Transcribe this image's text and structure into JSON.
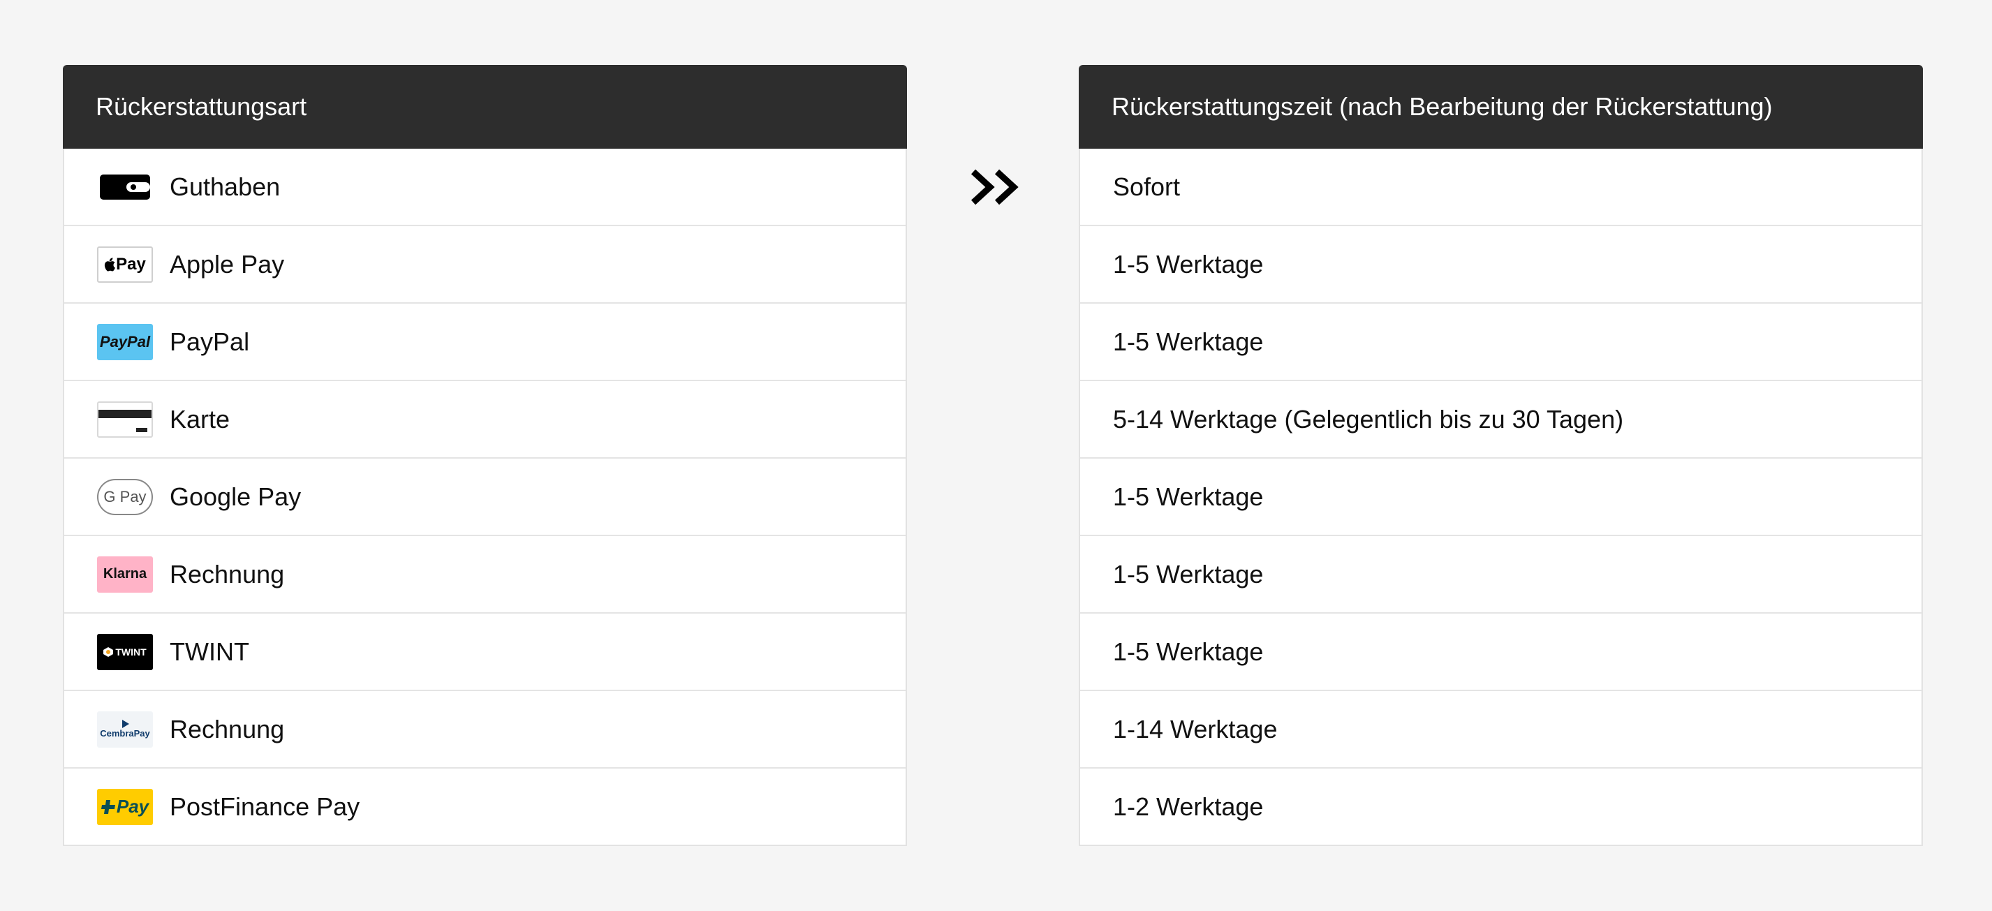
{
  "left_table": {
    "header": "Rückerstattungsart",
    "rows": [
      {
        "label": "Guthaben",
        "icon": "wallet-icon",
        "logo_text": ""
      },
      {
        "label": "Apple Pay",
        "icon": "apple-pay-logo",
        "logo_text": "Pay"
      },
      {
        "label": "PayPal",
        "icon": "paypal-logo",
        "logo_text": "PayPal"
      },
      {
        "label": "Karte",
        "icon": "card-icon",
        "logo_text": ""
      },
      {
        "label": "Google Pay",
        "icon": "google-pay-logo",
        "logo_text": "G Pay"
      },
      {
        "label": "Rechnung",
        "icon": "klarna-logo",
        "logo_text": "Klarna"
      },
      {
        "label": "TWINT",
        "icon": "twint-logo",
        "logo_text": "TWINT"
      },
      {
        "label": "Rechnung",
        "icon": "cembrapay-logo",
        "logo_text": "CembraPay"
      },
      {
        "label": "PostFinance Pay",
        "icon": "postfinance-pay-logo",
        "logo_text": "Pay"
      }
    ]
  },
  "right_table": {
    "header": "Rückerstattungszeit (nach Bearbeitung der Rückerstattung)",
    "rows": [
      {
        "label": "Sofort"
      },
      {
        "label": "1-5 Werktage"
      },
      {
        "label": "1-5 Werktage"
      },
      {
        "label": "5-14 Werktage (Gelegentlich bis zu 30 Tagen)"
      },
      {
        "label": "1-5 Werktage"
      },
      {
        "label": "1-5 Werktage"
      },
      {
        "label": "1-5 Werktage"
      },
      {
        "label": "1-14 Werktage"
      },
      {
        "label": "1-2 Werktage"
      }
    ]
  },
  "arrow_icon": "double-chevron-right-icon",
  "colors": {
    "header_bg": "#2d2d2d",
    "page_bg": "#f5f5f5",
    "paypal": "#5bc4f1",
    "klarna": "#ffb3c7",
    "postfinance": "#ffcc00"
  }
}
